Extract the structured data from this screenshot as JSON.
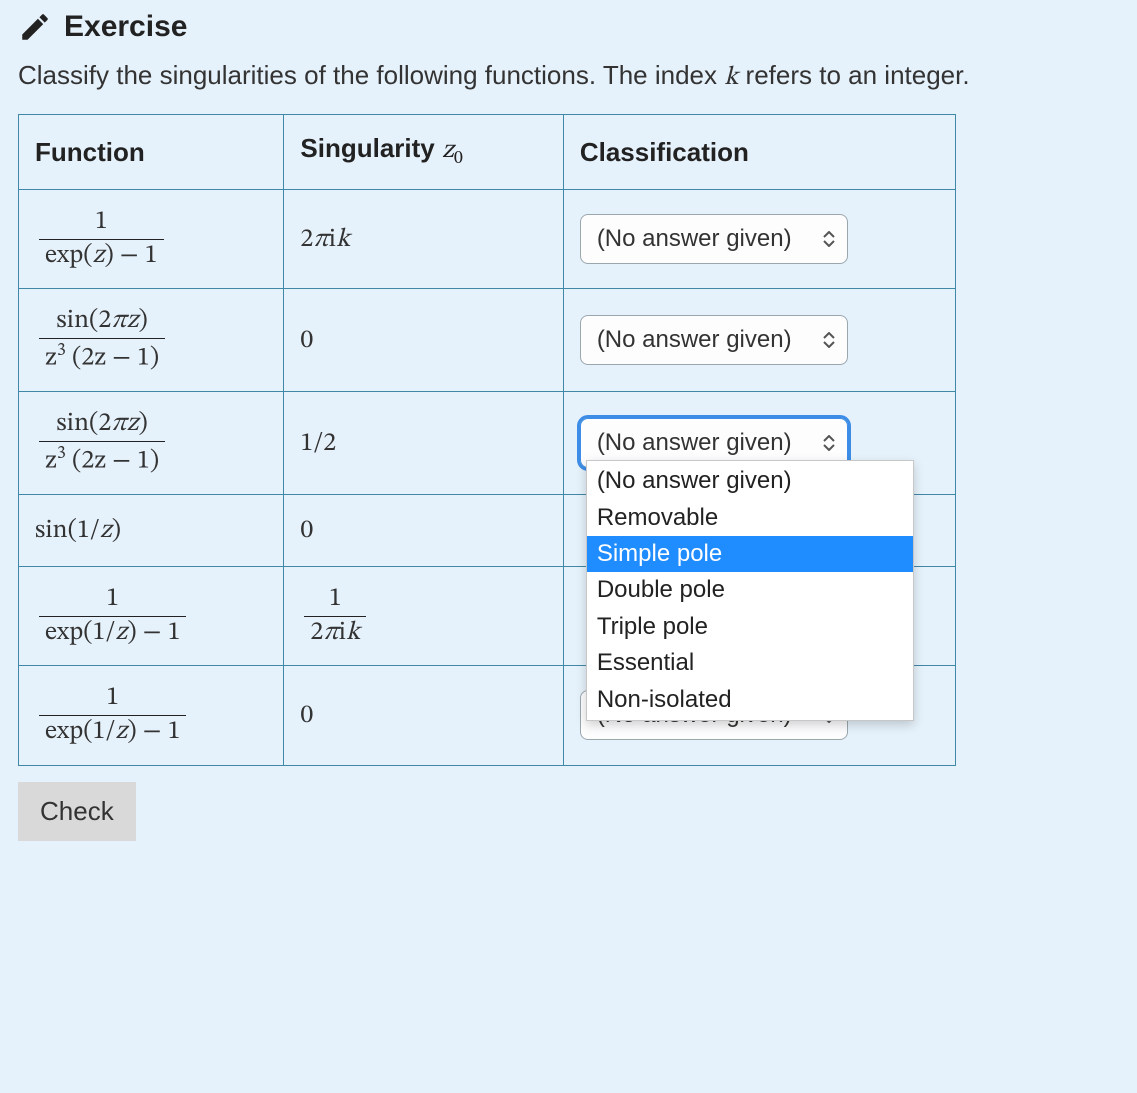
{
  "header": {
    "title": "Exercise",
    "icon": "pencil-icon"
  },
  "prompt": {
    "text_before_k": "Classify the singularities of the following functions.  The index ",
    "k": "k",
    "text_after_k": " refers to an integer."
  },
  "table": {
    "headers": {
      "function": "Function",
      "singularity_label": "Singularity ",
      "singularity_var": "z",
      "singularity_sub": "0",
      "classification": "Classification"
    },
    "rows": [
      {
        "function": {
          "type": "frac",
          "num": "1",
          "den": "exp(z) − 1"
        },
        "singularity": {
          "type": "inline",
          "text": "2πik"
        },
        "select": {
          "value": "(No answer given)",
          "focused": false,
          "open": false
        }
      },
      {
        "function": {
          "type": "frac",
          "num": "sin(2πz)",
          "den_html": "z<span class=\"sup\">3</span> (2z − 1)"
        },
        "singularity": {
          "type": "inline",
          "text": "0"
        },
        "select": {
          "value": "(No answer given)",
          "focused": false,
          "open": false
        }
      },
      {
        "function": {
          "type": "frac",
          "num": "sin(2πz)",
          "den_html": "z<span class=\"sup\">3</span> (2z − 1)"
        },
        "singularity": {
          "type": "inline",
          "text": "1/2"
        },
        "select": {
          "value": "(No answer given)",
          "focused": true,
          "open": true,
          "highlight_index": 2
        }
      },
      {
        "function": {
          "type": "inline",
          "text": "sin(1/z)"
        },
        "singularity": {
          "type": "inline",
          "text": "0"
        },
        "select": null
      },
      {
        "function": {
          "type": "frac",
          "num": "1",
          "den": "exp(1/z) − 1"
        },
        "singularity": {
          "type": "frac",
          "num": "1",
          "den": "2πik"
        },
        "select": null
      },
      {
        "function": {
          "type": "frac",
          "num": "1",
          "den": "exp(1/z) − 1"
        },
        "singularity": {
          "type": "inline",
          "text": "0"
        },
        "select": {
          "value": "(No answer given)",
          "focused": false,
          "open": false
        }
      }
    ]
  },
  "dropdown_options": [
    "(No answer given)",
    "Removable",
    "Simple pole",
    "Double pole",
    "Triple pole",
    "Essential",
    "Non-isolated"
  ],
  "buttons": {
    "check": "Check"
  }
}
